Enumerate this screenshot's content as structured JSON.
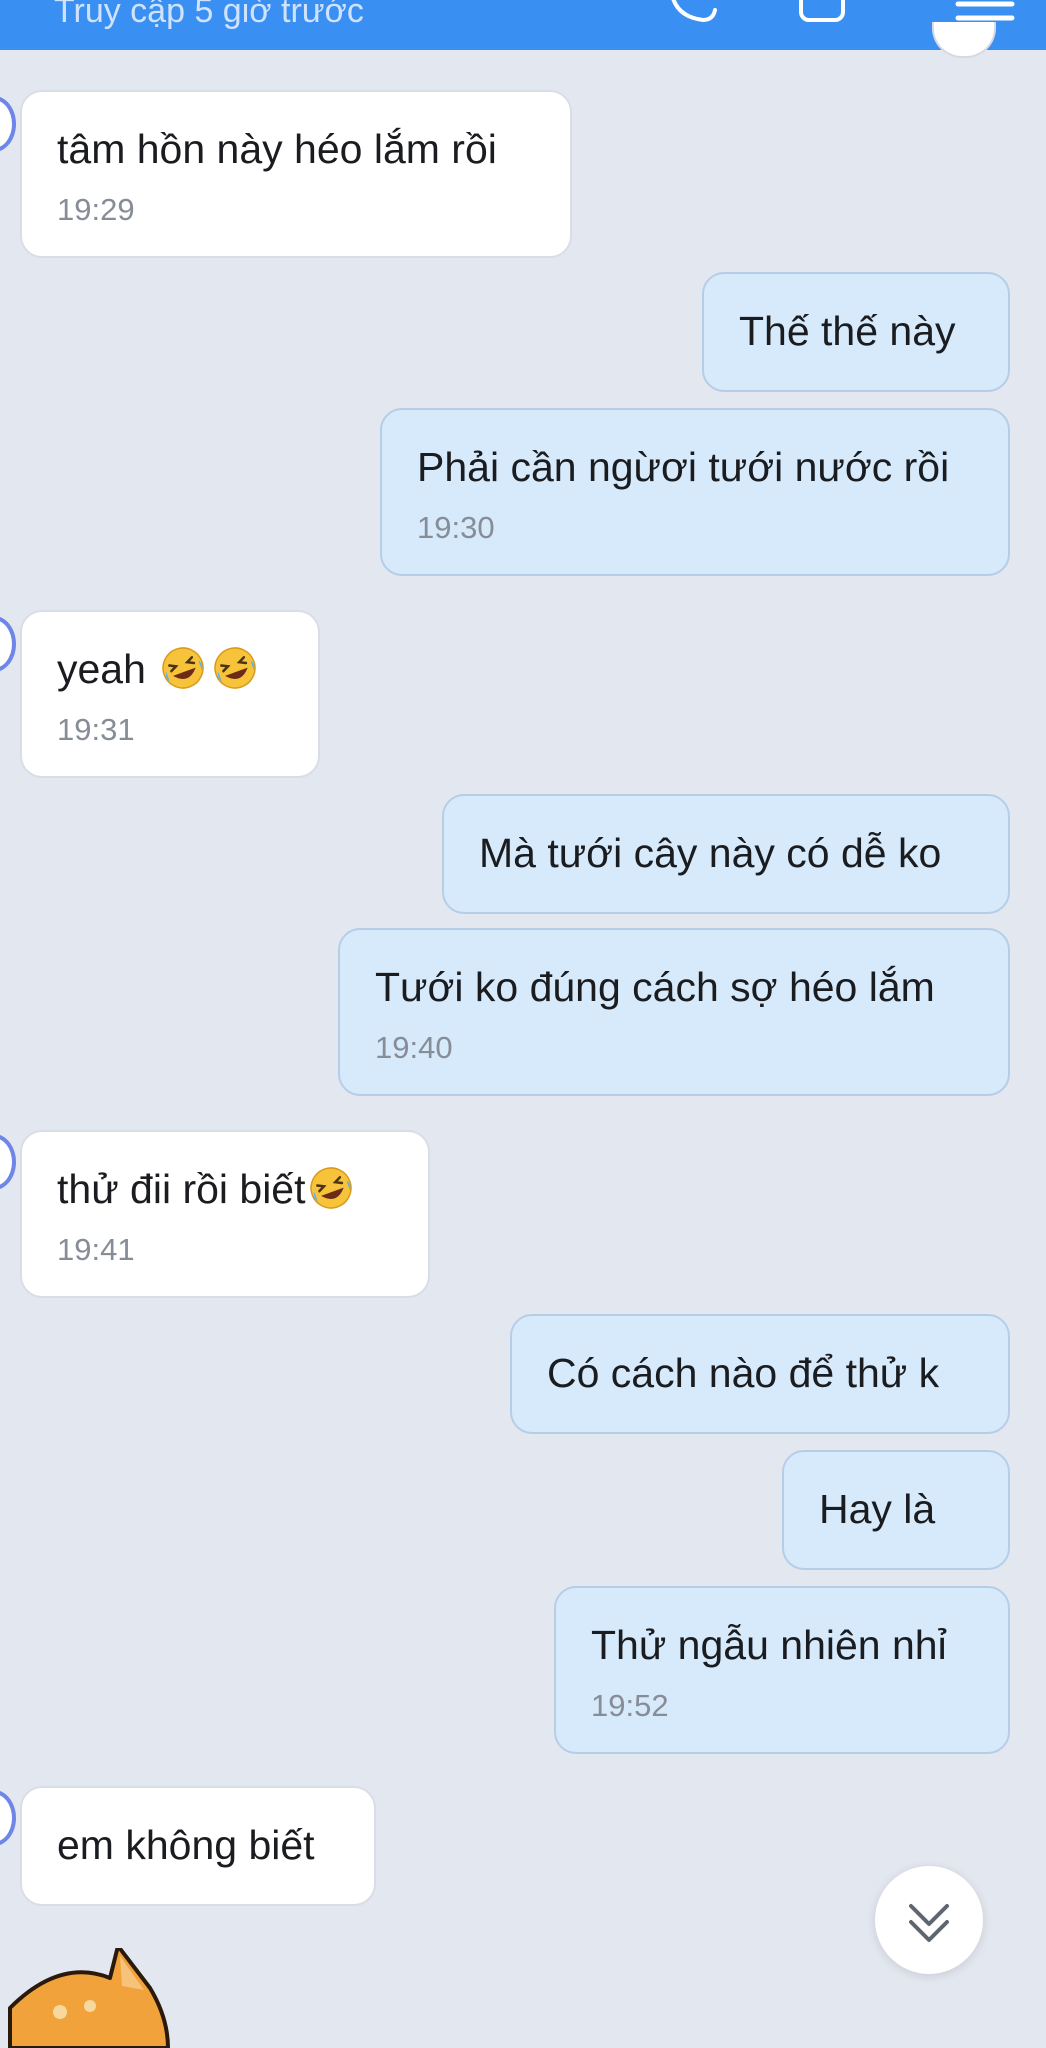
{
  "header": {
    "status": "Truy cập 5 giờ trước"
  },
  "messages": [
    {
      "from": "them",
      "text": "tâm hồn này héo lắm rồi",
      "time": "19:29"
    },
    {
      "from": "me",
      "text": "Thế thế này"
    },
    {
      "from": "me",
      "text": "Phải cần ngừơi tưới nước rồi",
      "time": "19:30"
    },
    {
      "from": "them",
      "text": "yeah",
      "emoji": "rolling-on-floor-laughing x2",
      "time": "19:31"
    },
    {
      "from": "me",
      "text": "Mà tưới cây này có dễ ko"
    },
    {
      "from": "me",
      "text": "Tưới ko đúng cách sợ héo lắm",
      "time": "19:40"
    },
    {
      "from": "them",
      "text": "thử đii rồi biết",
      "emoji": "rolling-on-floor-laughing",
      "time": "19:41"
    },
    {
      "from": "me",
      "text": "Có cách nào để thử k"
    },
    {
      "from": "me",
      "text": "Hay là"
    },
    {
      "from": "me",
      "text": "Thử ngẫu nhiên nhỉ",
      "time": "19:52"
    },
    {
      "from": "them",
      "text": "em không biết"
    }
  ],
  "icons": {
    "header_left": "video-call-icon",
    "header_middle": "search-icon",
    "header_right": "menu-icon",
    "scroll_button": "double-chevron-down-icon",
    "sticker": "shiba-dog-sticker"
  },
  "colors": {
    "header": "#3a8ff2",
    "background": "#e3e7f0",
    "incoming_bubble": "#ffffff",
    "outgoing_bubble": "#d6eafc"
  }
}
